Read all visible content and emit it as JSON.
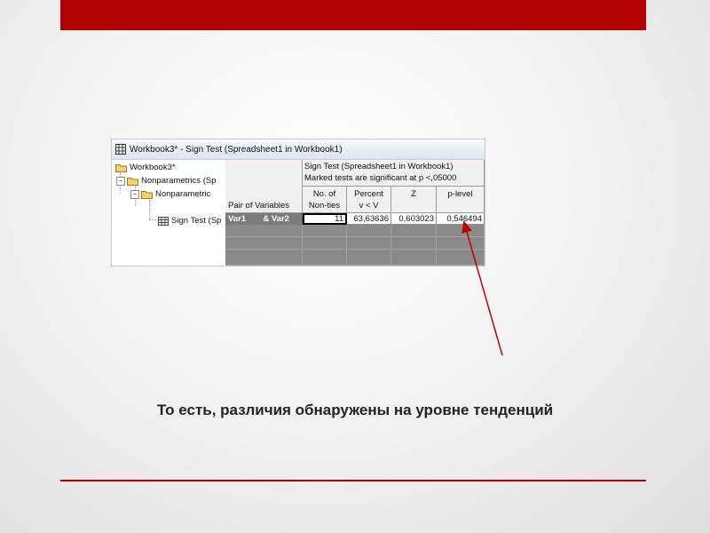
{
  "window": {
    "title": "Workbook3* - Sign Test (Spreadsheet1 in Workbook1)"
  },
  "tree": {
    "root": "Workbook3*",
    "items": [
      {
        "label": "Nonparametrics (Sp"
      },
      {
        "label": "Nonparametric"
      },
      {
        "label": "Sign Test (Sp"
      }
    ]
  },
  "table": {
    "title_line1": "Sign Test (Spreadsheet1 in Workbook1)",
    "title_line2": "Marked tests are significant at p <,05000",
    "pair_header": "Pair of Variables",
    "columns": [
      {
        "line1": "No. of",
        "line2": "Non-ties"
      },
      {
        "line1": "Percent",
        "line2": "v < V"
      },
      {
        "line1": "Z",
        "line2": ""
      },
      {
        "line1": "p-level",
        "line2": ""
      }
    ],
    "rows": [
      {
        "var1": "Var1",
        "var2": "& Var2",
        "values": [
          "11",
          "63,63636",
          "0,603023",
          "0,546494"
        ]
      }
    ]
  },
  "caption": "То есть, различия обнаружены на уровне тенденций",
  "colors": {
    "accent": "#b30000",
    "arrow": "#c00000"
  }
}
